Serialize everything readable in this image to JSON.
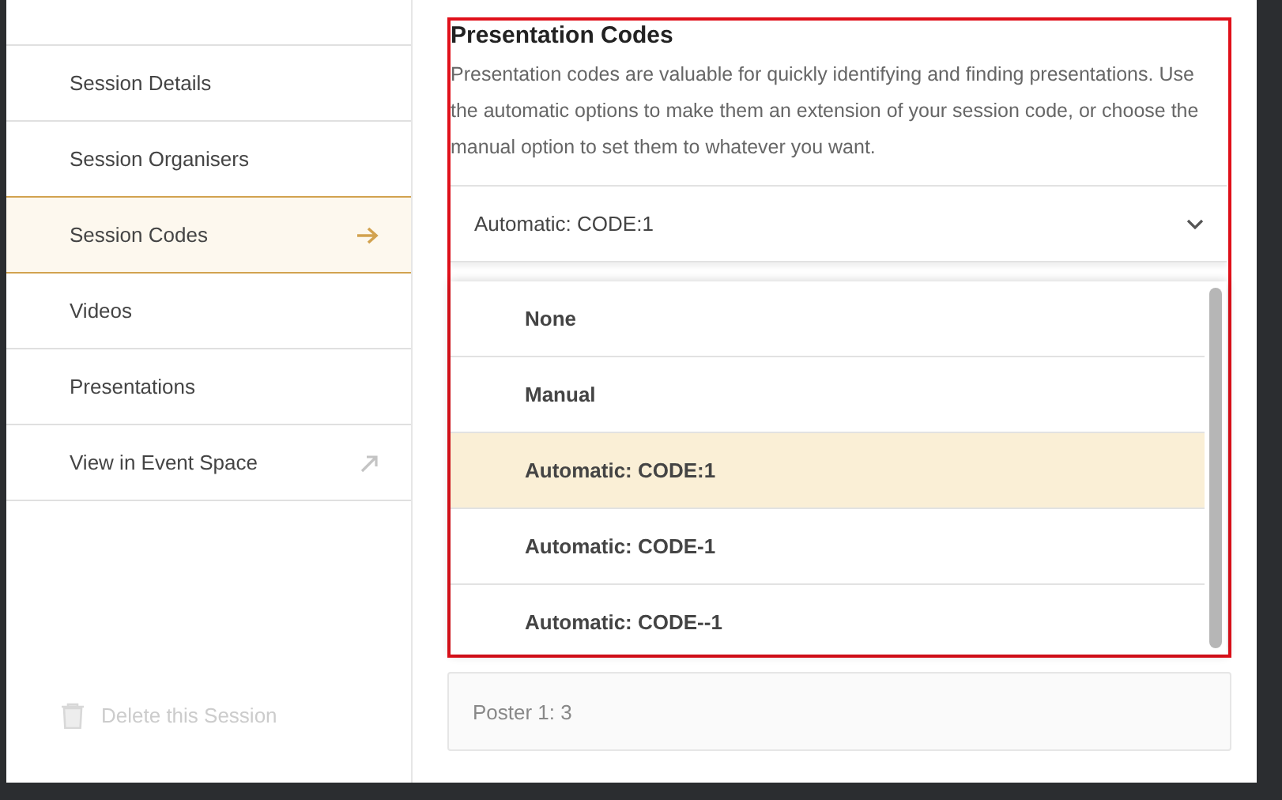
{
  "sidebar": {
    "items": [
      {
        "label": "Session Details",
        "selected": false,
        "kind": "page"
      },
      {
        "label": "Session Organisers",
        "selected": false,
        "kind": "page"
      },
      {
        "label": "Session Codes",
        "selected": true,
        "kind": "page"
      },
      {
        "label": "Videos",
        "selected": false,
        "kind": "page"
      },
      {
        "label": "Presentations",
        "selected": false,
        "kind": "page"
      },
      {
        "label": "View in Event Space",
        "selected": false,
        "kind": "external"
      }
    ],
    "delete_action": {
      "label": "Delete this Session",
      "disabled": true
    }
  },
  "section": {
    "title": "Presentation Codes",
    "description": "Presentation codes are valuable for quickly identifying and finding presentations. Use the automatic options to make them an extension of your session code, or choose the manual option to set them to whatever you want.",
    "select": {
      "value": "Automatic: CODE:1",
      "expanded": true
    },
    "options": [
      {
        "label": "None",
        "selected": false
      },
      {
        "label": "Manual",
        "selected": false
      },
      {
        "label": "Automatic: CODE:1",
        "selected": true
      },
      {
        "label": "Automatic: CODE-1",
        "selected": false
      },
      {
        "label": "Automatic: CODE--1",
        "selected": false
      }
    ]
  },
  "poster_field": {
    "value": "Poster 1: 3"
  }
}
